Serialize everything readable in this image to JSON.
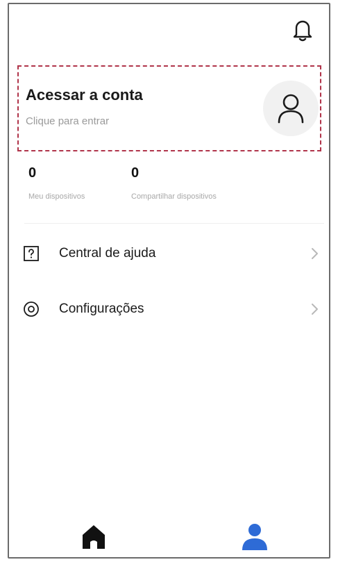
{
  "account": {
    "title": "Acessar a conta",
    "subtitle": "Clique para entrar"
  },
  "stats": [
    {
      "value": "0",
      "label": "Meu dispositivos"
    },
    {
      "value": "0",
      "label": "Compartilhar dispositivos"
    }
  ],
  "menu": [
    {
      "label": "Central de ajuda",
      "icon": "help-icon"
    },
    {
      "label": "Configurações",
      "icon": "settings-icon"
    }
  ],
  "tabs": [
    {
      "name": "home",
      "icon": "home-icon",
      "active": false
    },
    {
      "name": "profile",
      "icon": "user-icon",
      "active": true
    }
  ],
  "colors": {
    "accent": "#2e6bd6",
    "account_border": "#b0344a",
    "muted_text": "#9a9a9a",
    "avatar_bg": "#f1f1f1"
  }
}
